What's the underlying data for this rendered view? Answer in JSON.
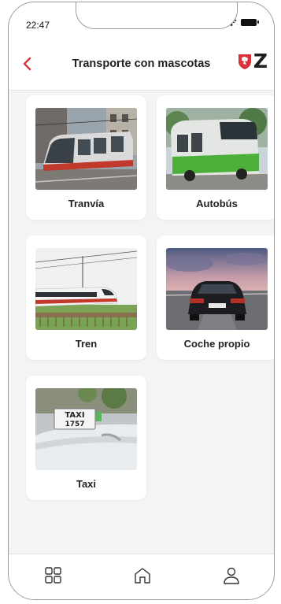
{
  "status_bar": {
    "time": "22:47"
  },
  "header": {
    "title": "Transporte con mascotas",
    "logo_letter": "Z"
  },
  "cards": [
    {
      "label": "Tranvía"
    },
    {
      "label": "Autobús"
    },
    {
      "label": "Tren"
    },
    {
      "label": "Coche propio"
    },
    {
      "label": "Taxi",
      "sign_text_1": "TAXI",
      "sign_text_2": "1757"
    }
  ],
  "tabbar": {
    "items": [
      "grid-icon",
      "home-icon",
      "profile-icon"
    ]
  },
  "colors": {
    "accent": "#d6343a",
    "background": "#f4f4f5",
    "card": "#ffffff"
  }
}
